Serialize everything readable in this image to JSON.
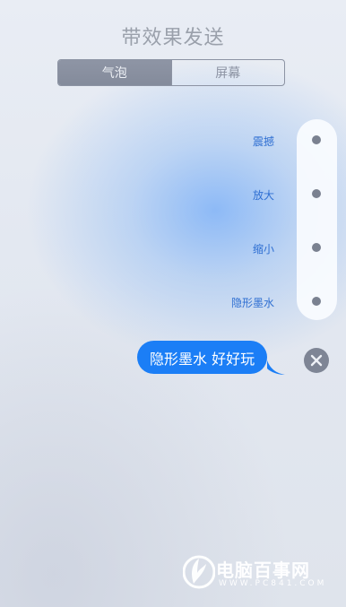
{
  "header": {
    "title": "带效果发送"
  },
  "segment_control": {
    "selected": "气泡",
    "options": [
      "气泡",
      "屏幕"
    ]
  },
  "effects": {
    "items": [
      "震撼",
      "放大",
      "缩小",
      "隐形墨水"
    ],
    "selected": "隐形墨水"
  },
  "message": {
    "text": "隐形墨水 好好玩"
  },
  "icons": {
    "close": "close-icon",
    "watermark_logo": "pc841-logo-icon"
  },
  "watermark": {
    "text": "电脑百事网",
    "url": "WWW.PC841.COM"
  },
  "colors": {
    "bubble": "#1b7ef6",
    "accent_label": "#2f6fd2",
    "control_gray": "#8c93a3"
  }
}
